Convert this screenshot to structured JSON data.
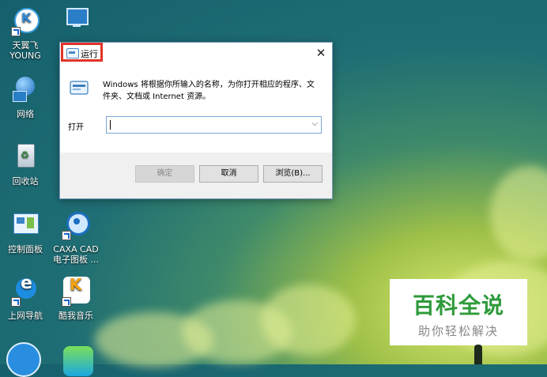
{
  "desktop": {
    "icons": [
      {
        "label": "天翼飞\nYOUNG"
      },
      {
        "label": "网络"
      },
      {
        "label": "回收站"
      },
      {
        "label": "控制面板"
      },
      {
        "label": "上网导航"
      },
      {
        "label": "CAXA CAD\n电子图板 ..."
      },
      {
        "label": "酷我音乐"
      }
    ]
  },
  "run_dialog": {
    "title": "运行",
    "description": "Windows 将根据你所输入的名称，为你打开相应的程序、文件夹、文档或 Internet 资源。",
    "open_label": "打开",
    "input_value": "",
    "ok_label": "确定",
    "cancel_label": "取消",
    "browse_label": "浏览(B)..."
  },
  "watermark": {
    "title": "百科全说",
    "subtitle": "助你轻松解决"
  }
}
